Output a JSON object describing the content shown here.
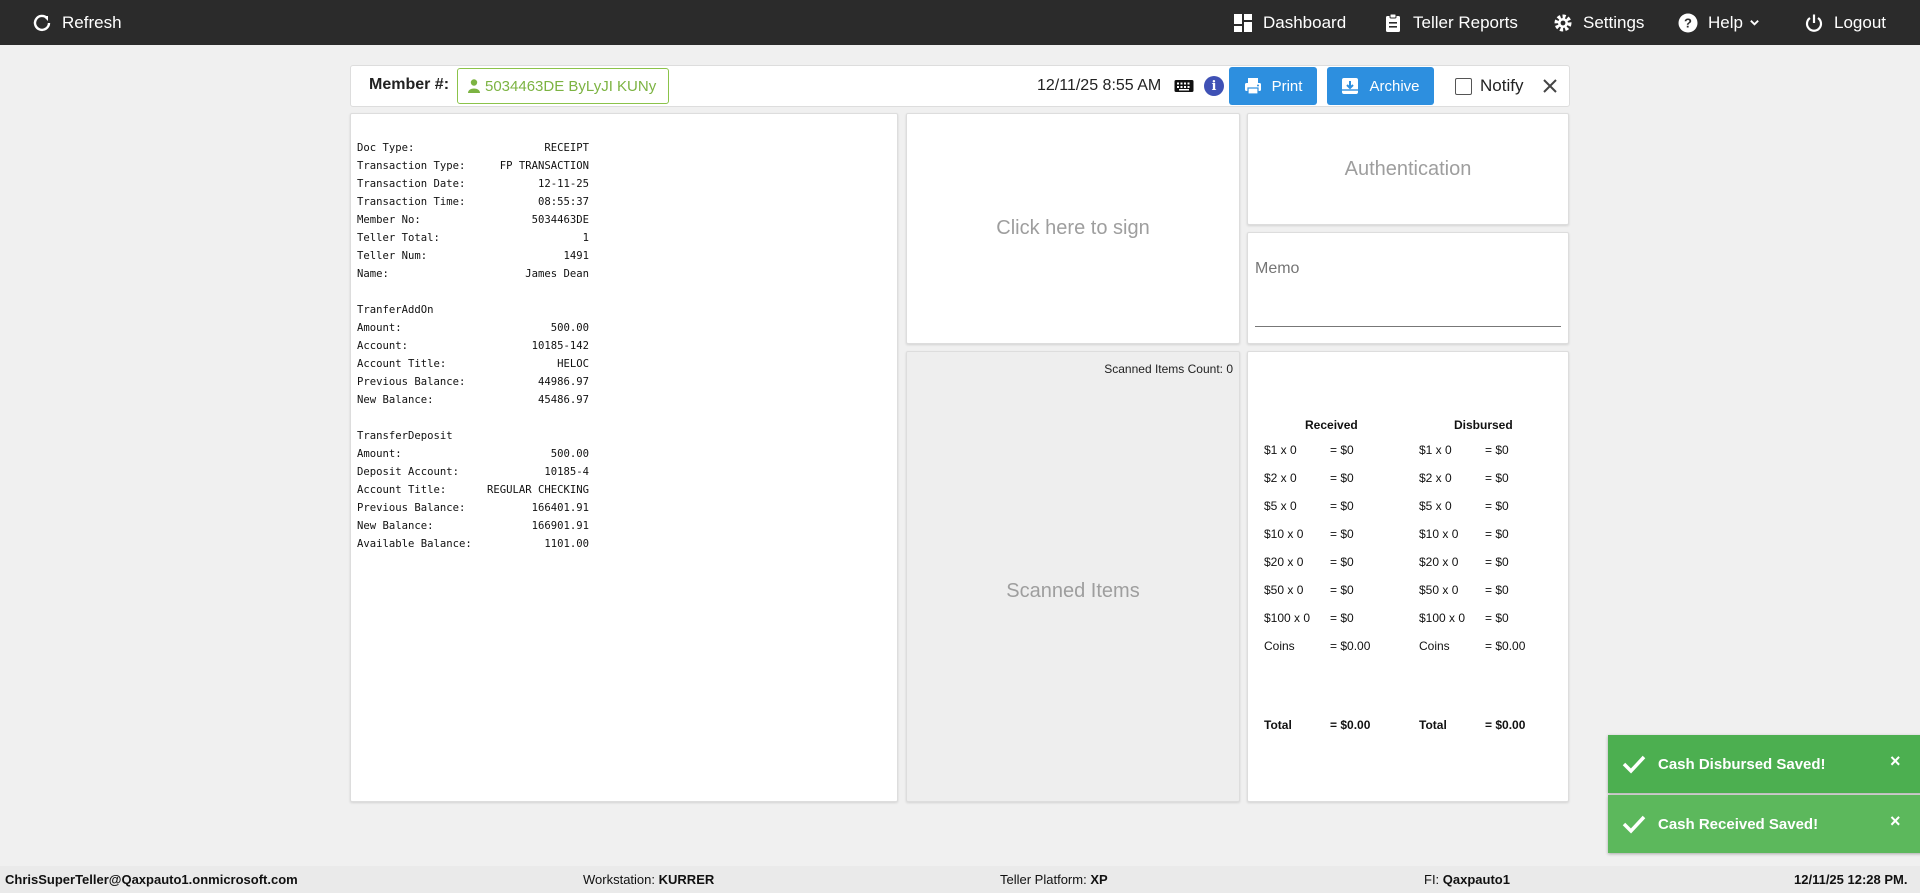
{
  "nav": {
    "refresh": "Refresh",
    "dashboard": "Dashboard",
    "teller_reports": "Teller Reports",
    "settings": "Settings",
    "help": "Help",
    "logout": "Logout"
  },
  "header": {
    "member_label": "Member #:",
    "member_value": "5034463DE ByLyJI KUNy",
    "datetime": "12/11/25 8:55 AM",
    "info_glyph": "i",
    "print": "Print",
    "archive": "Archive",
    "notify": "Notify"
  },
  "receipt": {
    "doc": [
      {
        "label": "Doc Type:",
        "value": "RECEIPT"
      },
      {
        "label": "Transaction Type:",
        "value": "FP TRANSACTION"
      },
      {
        "label": "Transaction Date:",
        "value": "12-11-25"
      },
      {
        "label": "Transaction Time:",
        "value": "08:55:37"
      },
      {
        "label": "Member No:",
        "value": "5034463DE"
      },
      {
        "label": "Teller Total:",
        "value": "1"
      },
      {
        "label": "Teller Num:",
        "value": "1491"
      },
      {
        "label": "Name:",
        "value": "James Dean"
      }
    ],
    "section1_title": "TranferAddOn",
    "section1": [
      {
        "label": "Amount:",
        "value": "500.00"
      },
      {
        "label": "Account:",
        "value": "10185-142"
      },
      {
        "label": "Account Title:",
        "value": "HELOC"
      },
      {
        "label": "Previous Balance:",
        "value": "44986.97"
      },
      {
        "label": "New Balance:",
        "value": "45486.97"
      }
    ],
    "section2_title": "TransferDeposit",
    "section2": [
      {
        "label": "Amount:",
        "value": "500.00"
      },
      {
        "label": "Deposit Account:",
        "value": "10185-4"
      },
      {
        "label": "Account Title:",
        "value": "REGULAR CHECKING"
      },
      {
        "label": "Previous Balance:",
        "value": "166401.91"
      },
      {
        "label": "New Balance:",
        "value": "166901.91"
      },
      {
        "label": "Available Balance:",
        "value": "1101.00"
      }
    ]
  },
  "sign": {
    "text": "Click here to sign"
  },
  "scanned": {
    "count_text": "Scanned Items Count: 0",
    "title": "Scanned Items"
  },
  "auth": {
    "text": "Authentication"
  },
  "memo": {
    "label": "Memo"
  },
  "cash": {
    "received_header": "Received",
    "disbursed_header": "Disbursed",
    "received": [
      {
        "label": "$1 x 0",
        "value": "= $0"
      },
      {
        "label": "$2 x 0",
        "value": "= $0"
      },
      {
        "label": "$5 x 0",
        "value": "= $0"
      },
      {
        "label": "$10 x 0",
        "value": "= $0"
      },
      {
        "label": "$20 x 0",
        "value": "= $0"
      },
      {
        "label": "$50 x 0",
        "value": "= $0"
      },
      {
        "label": "$100 x 0",
        "value": "= $0"
      },
      {
        "label": "Coins",
        "value": "= $0.00"
      }
    ],
    "disbursed": [
      {
        "label": "$1 x 0",
        "value": "= $0"
      },
      {
        "label": "$2 x 0",
        "value": "= $0"
      },
      {
        "label": "$5 x 0",
        "value": "= $0"
      },
      {
        "label": "$10 x 0",
        "value": "= $0"
      },
      {
        "label": "$20 x 0",
        "value": "= $0"
      },
      {
        "label": "$50 x 0",
        "value": "= $0"
      },
      {
        "label": "$100 x 0",
        "value": "= $0"
      },
      {
        "label": "Coins",
        "value": "= $0.00"
      }
    ],
    "received_total_label": "Total",
    "received_total_value": "= $0.00",
    "disbursed_total_label": "Total",
    "disbursed_total_value": "= $0.00"
  },
  "toasts": [
    {
      "text": "Cash Disbursed Saved!",
      "close": "×"
    },
    {
      "text": "Cash Received Saved!",
      "close": "×"
    }
  ],
  "footer": {
    "user": "ChrisSuperTeller@Qaxpauto1.onmicrosoft.com",
    "workstation_label": "Workstation:",
    "workstation_value": "KURRER",
    "platform_label": "Teller Platform:",
    "platform_value": "XP",
    "fi_label": "FI:",
    "fi_value": "Qaxpauto1",
    "timestamp": "12/11/25 12:28 PM."
  },
  "colors": {
    "nav_bg": "#2b2b2b",
    "button_blue": "#2d8fdf",
    "member_green": "#7cb342",
    "toast_green": "#4caf50",
    "info_blue": "#3f51b5"
  }
}
